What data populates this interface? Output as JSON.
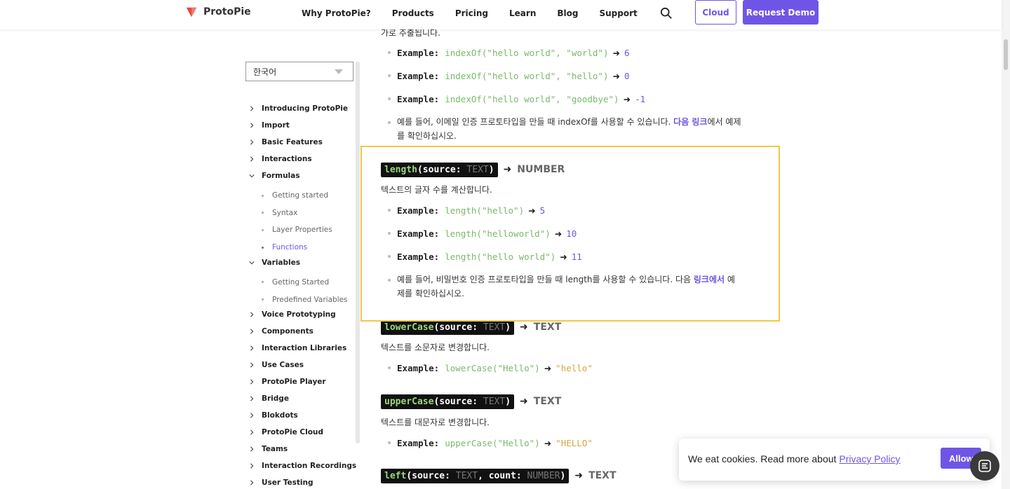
{
  "header": {
    "logo_text": "ProtoPie",
    "nav": [
      "Why ProtoPie?",
      "Products",
      "Pricing",
      "Learn",
      "Blog",
      "Support"
    ],
    "cloud_label": "Cloud",
    "demo_label": "Request Demo"
  },
  "sidebar": {
    "language": "한국어",
    "items": [
      {
        "label": "Introducing ProtoPie",
        "expanded": false
      },
      {
        "label": "Import",
        "expanded": false
      },
      {
        "label": "Basic Features",
        "expanded": false
      },
      {
        "label": "Interactions",
        "expanded": false
      },
      {
        "label": "Formulas",
        "expanded": true
      },
      {
        "label": "Variables",
        "expanded": true
      },
      {
        "label": "Voice Prototyping",
        "expanded": false
      },
      {
        "label": "Components",
        "expanded": false
      },
      {
        "label": "Interaction Libraries",
        "expanded": false
      },
      {
        "label": "Use Cases",
        "expanded": false
      },
      {
        "label": "ProtoPie Player",
        "expanded": false
      },
      {
        "label": "Bridge",
        "expanded": false
      },
      {
        "label": "Blokdots",
        "expanded": false
      },
      {
        "label": "ProtoPie Cloud",
        "expanded": false
      },
      {
        "label": "Teams",
        "expanded": false
      },
      {
        "label": "Interaction Recordings",
        "expanded": false
      },
      {
        "label": "User Testing",
        "expanded": false
      }
    ],
    "formulas_sub": [
      "Getting started",
      "Syntax",
      "Layer Properties",
      "Functions"
    ],
    "variables_sub": [
      "Getting Started",
      "Predefined Variables"
    ],
    "active_sub": "Functions"
  },
  "content": {
    "cut_line": "가로 추출됩니다.",
    "example_label": "Example:",
    "arrow": "➜",
    "indexof_examples": [
      {
        "code": "indexOf(\"hello world\", \"world\")",
        "result": "6"
      },
      {
        "code": "indexOf(\"hello world\", \"hello\")",
        "result": "0"
      },
      {
        "code": "indexOf(\"hello world\", \"goodbye\")",
        "result": "-1"
      }
    ],
    "indexof_note_1": "예를 들어, 이메일 인증 프로토타입을 만들 때 indexOf를 사용할 수 있습니다. ",
    "indexof_note_link": "다음 링크",
    "indexof_note_2": "에서 예제",
    "indexof_note_3": "를 확인하십시오.",
    "length": {
      "fn": "length",
      "param": "source",
      "type": "TEXT",
      "returns": "NUMBER",
      "desc": "텍스트의 글자 수를 계산합니다.",
      "examples": [
        {
          "code": "length(\"hello\")",
          "result": "5"
        },
        {
          "code": "length(\"helloworld\")",
          "result": "10"
        },
        {
          "code": "length(\"hello world\")",
          "result": "11"
        }
      ],
      "note_1": "예를 들어, 비밀번호 인증 프로토타입을 만들 때 length를 사용할 수 있습니다. 다음 ",
      "note_link": "링크에서",
      "note_2": " 예",
      "note_3": "제를 확인하십시오."
    },
    "lowercase": {
      "fn": "lowerCase",
      "param": "source",
      "type": "TEXT",
      "returns": "TEXT",
      "desc": "텍스트를 소문자로 변경합니다.",
      "example_code": "lowerCase(\"Hello\")",
      "example_result": "\"hello\""
    },
    "uppercase": {
      "fn": "upperCase",
      "param": "source",
      "type": "TEXT",
      "returns": "TEXT",
      "desc": "텍스트를 대문자로 변경합니다.",
      "example_code": "upperCase(\"Hello\")",
      "example_result": "\"HELLO\""
    },
    "left": {
      "fn": "left",
      "param1": "source",
      "type1": "TEXT",
      "param2": "count",
      "type2": "NUMBER",
      "returns": "TEXT"
    }
  },
  "cookie": {
    "text": "We eat cookies. Read more about",
    "link": "Privacy Policy",
    "button": "Allow"
  },
  "colors": {
    "accent": "#6f55e6",
    "highlight": "#f2c744",
    "code_green": "#7ab86b"
  }
}
